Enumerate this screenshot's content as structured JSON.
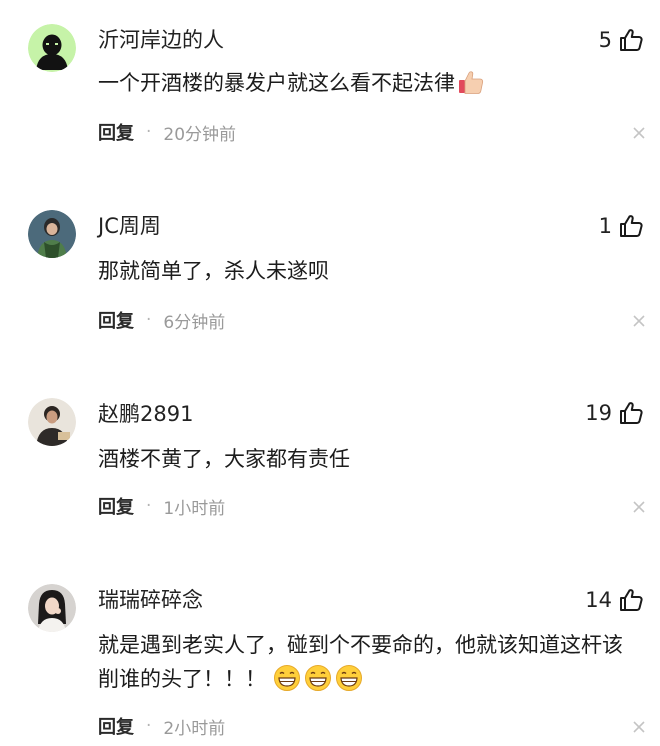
{
  "comments": [
    {
      "username": "沂河岸边的人",
      "likes": "5",
      "text": "一个开酒楼的暴发户就这么看不起法律",
      "reply_label": "回复",
      "separator": "·",
      "time": "20分钟前",
      "emoji": "thumbs-up-icon"
    },
    {
      "username": "JC周周",
      "likes": "1",
      "text": "那就简单了，杀人未遂呗",
      "reply_label": "回复",
      "separator": "·",
      "time": "6分钟前"
    },
    {
      "username": "赵鹏2891",
      "likes": "19",
      "text": "酒楼不黄了，大家都有责任",
      "reply_label": "回复",
      "separator": "·",
      "time": "1小时前"
    },
    {
      "username": "瑞瑞碎碎念",
      "likes": "14",
      "text_line1": "就是遇到老实人了，碰到个不要命的，他就该知道这杆该",
      "text_line2": "削谁的头了！！！",
      "reply_label": "回复",
      "separator": "·",
      "time": "2小时前",
      "emoji": "grinning-face-icon"
    }
  ],
  "colors": {
    "text": "#1c1c1c",
    "meta": "#9a9a9a",
    "background": "#ffffff"
  }
}
